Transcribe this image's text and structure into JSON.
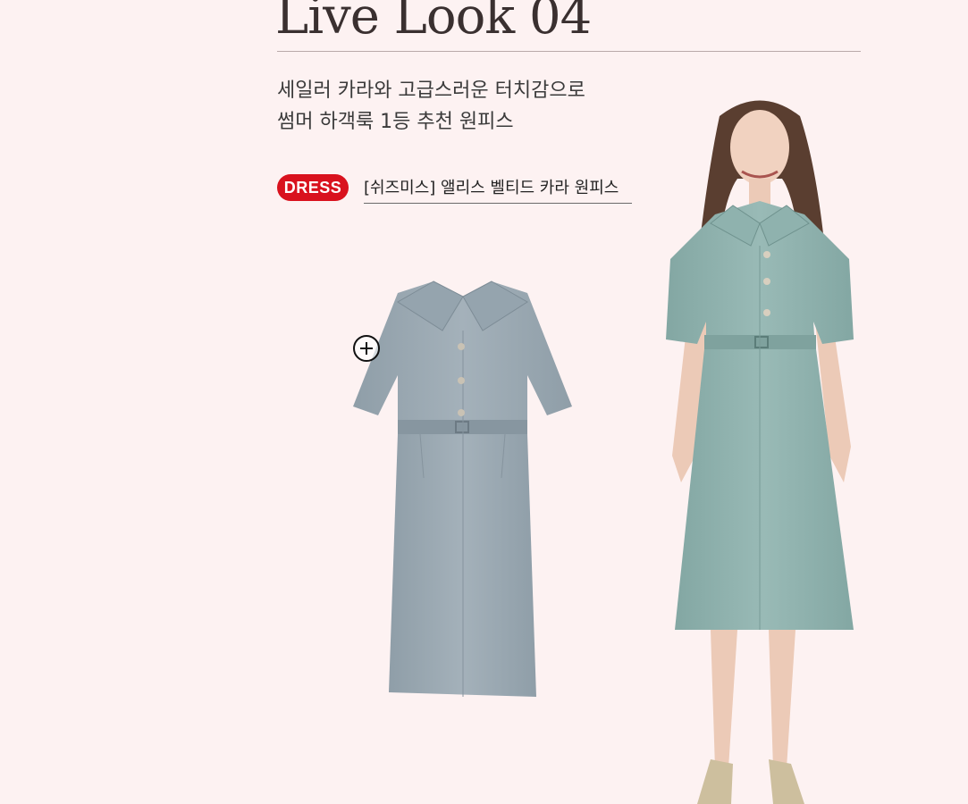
{
  "title": "Live Look 04",
  "subtitle": {
    "line1": "세일러 카라와 고급스러운 터치감으로",
    "line2": "썸머 하객룩 1등 추천 원피스"
  },
  "badge": "DRESS",
  "product": {
    "name": "[쉬즈미스] 앨리스 벨티드 카라 원피스"
  },
  "icons": {
    "zoom": "plus-circle-icon"
  },
  "colors": {
    "background": "#fdf2f2",
    "badge": "#d9121e",
    "dress_flat": "#9aa8b2",
    "dress_model": "#8fb2ae"
  }
}
